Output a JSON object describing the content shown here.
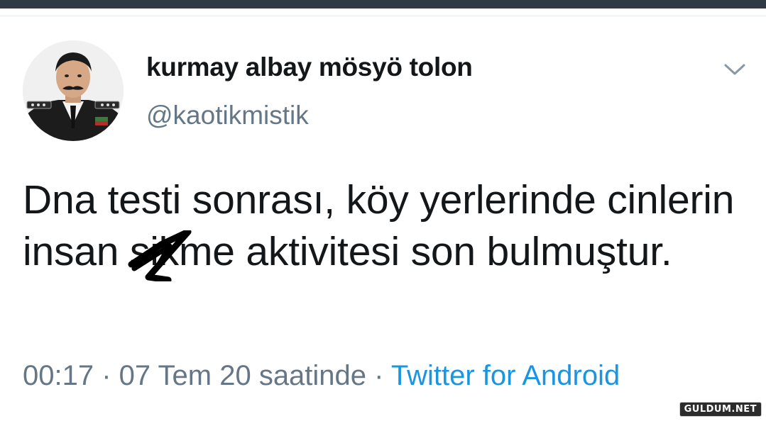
{
  "tweet": {
    "display_name": "kurmay albay mösyö tolon",
    "handle": "@kaotikmistik",
    "text_part1": "Dna testi sonrası, köy yerlerinde cinlerin insan ",
    "text_censored": "si",
    "text_part2": "kme aktivitesi son bulmuştur.",
    "timestamp": "00:17 · 07 Tem 20 saatinde · ",
    "source": "Twitter for Android"
  },
  "icons": {
    "menu": "chevron-down-icon",
    "avatar": "avatar-image"
  },
  "watermark": "GULDUM.NET",
  "colors": {
    "top_bar": "#2f3a44",
    "text": "#14171a",
    "muted": "#657786",
    "link": "#1b95e0"
  }
}
